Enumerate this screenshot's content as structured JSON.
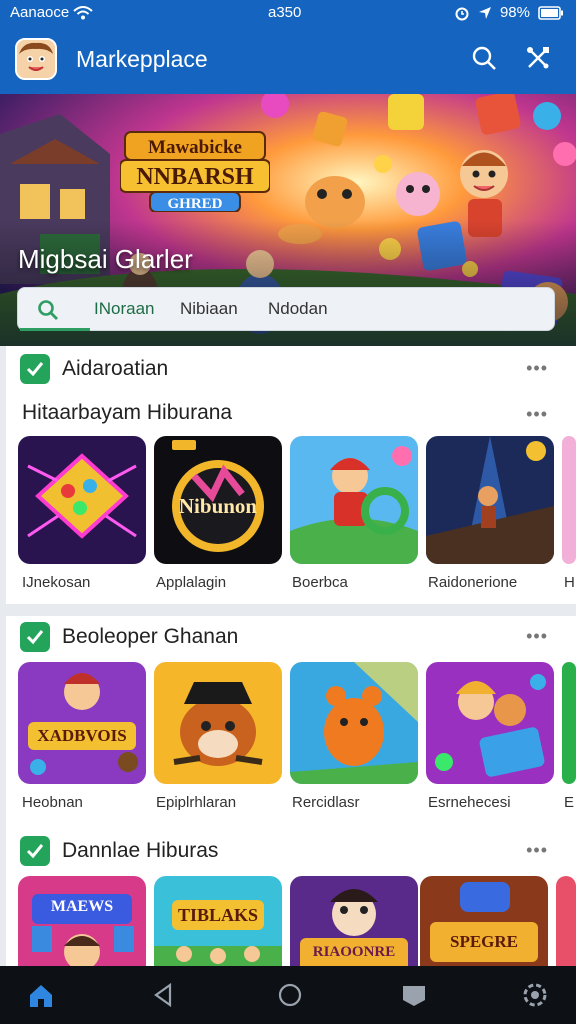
{
  "status_bar": {
    "carrier": "Aanaoce",
    "time": "a350",
    "battery": "98%"
  },
  "app_bar": {
    "title": "Markepplace"
  },
  "hero": {
    "title": "Migbsai Glarler",
    "logo_text": [
      "Mawabicke",
      "NNBARSH",
      "GHRED"
    ]
  },
  "search": {
    "tabs": [
      "INoraan",
      "Nibiaan",
      "Ndodan"
    ]
  },
  "sections": [
    {
      "title": "Aidaroatian",
      "subtitle": "Hitaarbayam Hiburana",
      "items": [
        "IJnekosan",
        "Applalagin",
        "Boerbca",
        "Raidonerione",
        "H"
      ]
    },
    {
      "title": "Beoleoper Ghanan",
      "items": [
        "Heobnan",
        "Epiplrhlaran",
        "Rercidlasr",
        "Esrnehecesi",
        "E"
      ]
    },
    {
      "title": "Dannlae Hiburas",
      "items": []
    }
  ],
  "tile_text": {
    "t1_2": "Nibunon",
    "t2_1": "XADBVOIS",
    "t3_1": "MAEWS",
    "t3_2": "TIBLAKS",
    "t3_3": "RIAOONRE",
    "t3_4": "SPEGRE"
  },
  "more_glyph": "•••",
  "colors": {
    "app_bar": "#1565c0",
    "accent_green": "#23a45a",
    "nav_bar": "#0d1116"
  }
}
